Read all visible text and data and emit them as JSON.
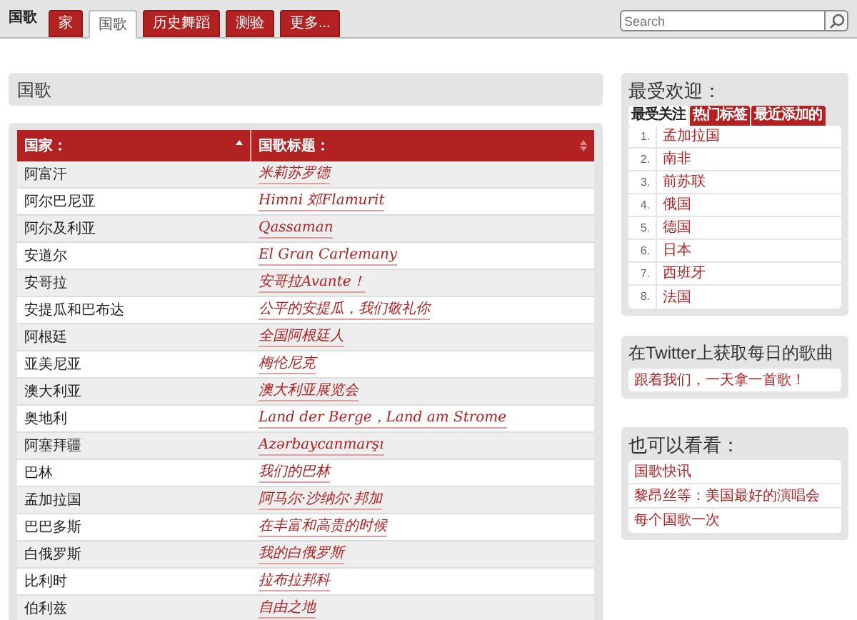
{
  "brand": "国歌",
  "nav": [
    {
      "label": "家",
      "selected": false
    },
    {
      "label": "国歌",
      "selected": true
    },
    {
      "label": "历史舞蹈",
      "selected": false
    },
    {
      "label": "测验",
      "selected": false
    },
    {
      "label": "更多..."
    }
  ],
  "search": {
    "placeholder": "Search"
  },
  "page_title": "国歌",
  "table": {
    "columns": [
      "国家：",
      "国歌标题："
    ],
    "rows": [
      [
        "阿富汗",
        "米莉苏罗德"
      ],
      [
        "阿尔巴尼亚",
        "Himni 郊Flamurit"
      ],
      [
        "阿尔及利亚",
        "Qassaman"
      ],
      [
        "安道尔",
        "El Gran Carlemany"
      ],
      [
        "安哥拉",
        "安哥拉Avante！"
      ],
      [
        "安提瓜和巴布达",
        "公平的安提瓜，我们敬礼你"
      ],
      [
        "阿根廷",
        "全国阿根廷人"
      ],
      [
        "亚美尼亚",
        "梅伦尼克"
      ],
      [
        "澳大利亚",
        "澳大利亚展览会"
      ],
      [
        "奥地利",
        "Land der Berge，Land am Strome"
      ],
      [
        "阿塞拜疆",
        "Azərbaycanmarşı"
      ],
      [
        "巴林",
        "我们的巴林"
      ],
      [
        "孟加拉国",
        "阿马尔·沙纳尔·邦加"
      ],
      [
        "巴巴多斯",
        "在丰富和高贵的时候"
      ],
      [
        "白俄罗斯",
        "我的白俄罗斯"
      ],
      [
        "比利时",
        "拉布拉邦科"
      ],
      [
        "伯利兹",
        "自由之地"
      ]
    ]
  },
  "popular": {
    "title": "最受欢迎：",
    "tabs": [
      {
        "label": "最受关注",
        "selected": true
      },
      {
        "label": "热门标签",
        "selected": false
      },
      {
        "label": "最近添加的",
        "selected": false
      }
    ],
    "items": [
      {
        "rank": "1.",
        "name": "孟加拉国"
      },
      {
        "rank": "2.",
        "name": "南非"
      },
      {
        "rank": "3.",
        "name": "前苏联"
      },
      {
        "rank": "4.",
        "name": "俄国"
      },
      {
        "rank": "5.",
        "name": "德国"
      },
      {
        "rank": "6.",
        "name": "日本"
      },
      {
        "rank": "7.",
        "name": "西班牙"
      },
      {
        "rank": "8.",
        "name": "法国"
      }
    ]
  },
  "twitter": {
    "title": "在Twitter上获取每日的歌曲",
    "link": "跟着我们，一天拿一首歌！"
  },
  "see_also": {
    "title": "也可以看看：",
    "links": [
      "国歌快讯",
      "黎昂丝等：美国最好的演唱会",
      "每个国歌一次"
    ]
  }
}
